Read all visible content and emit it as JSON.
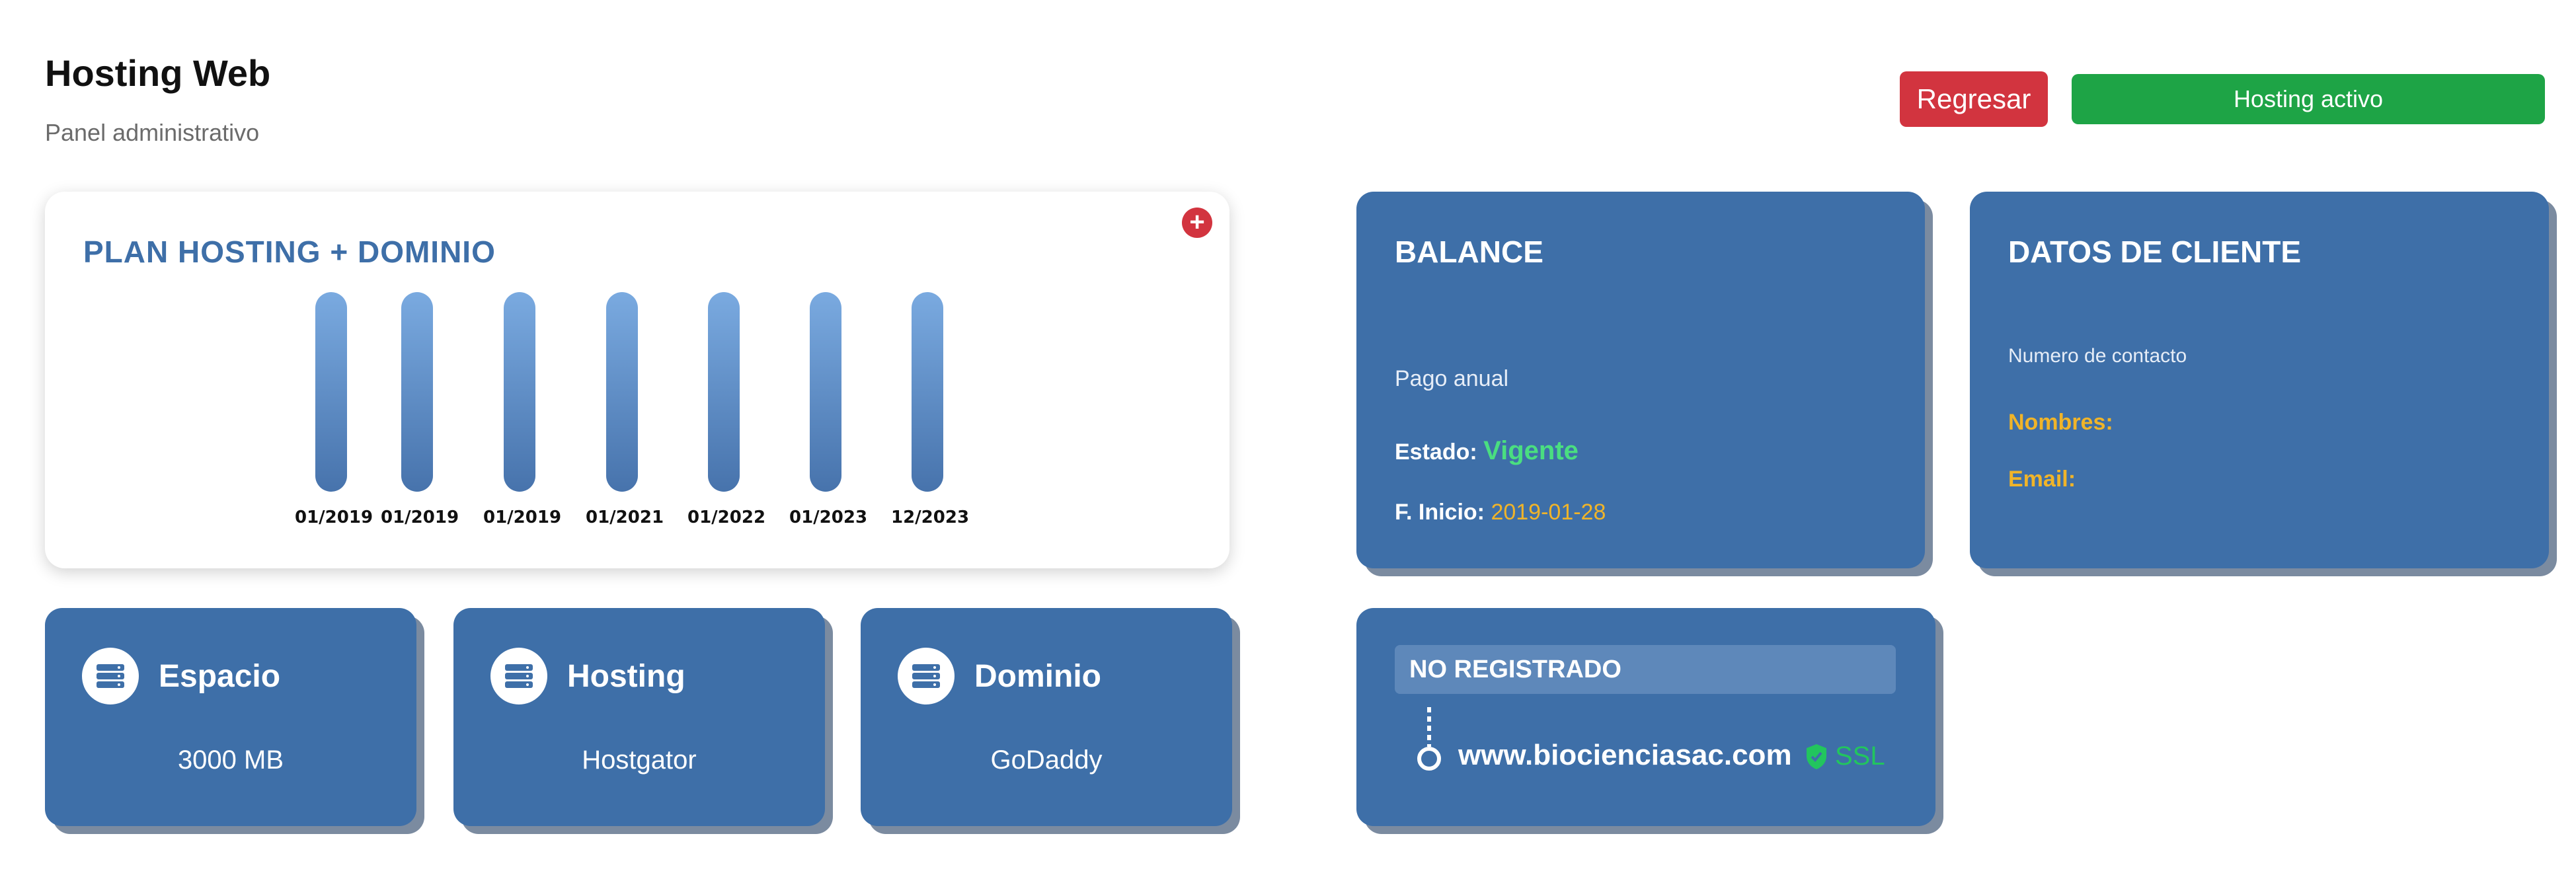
{
  "header": {
    "title": "Hosting Web",
    "subtitle": "Panel administrativo"
  },
  "actions": {
    "back_label": "Regresar",
    "status_label": "Hosting activo"
  },
  "plan": {
    "title": "PLAN HOSTING + DOMINIO",
    "add_label": "+",
    "timeline": [
      "01/2019",
      "01/2019",
      "01/2019",
      "01/2021",
      "01/2022",
      "01/2023",
      "12/2023"
    ]
  },
  "balance": {
    "title": "BALANCE",
    "payment": "Pago anual",
    "status_label": "Estado:",
    "status_value": "Vigente",
    "start_label": "F. Inicio:",
    "start_value": "2019-01-28"
  },
  "client": {
    "title": "DATOS DE CLIENTE",
    "contact_label": "Numero de contacto",
    "names_label": "Nombres:",
    "email_label": "Email:"
  },
  "resources": [
    {
      "title": "Espacio",
      "value": "3000 MB",
      "icon": "server-icon"
    },
    {
      "title": "Hosting",
      "value": "Hostgator",
      "icon": "server-icon"
    },
    {
      "title": "Dominio",
      "value": "GoDaddy",
      "icon": "server-icon"
    }
  ],
  "domain": {
    "badge": "NO REGISTRADO",
    "name": "www.biocienciasac.com",
    "ssl_label": "SSL",
    "ssl_icon": "shield-check-icon"
  },
  "colors": {
    "card_blue": "#3e6fa8",
    "danger": "#d2343f",
    "success": "#1ea446",
    "vigente": "#4ade80",
    "accent_yellow": "#f0b429"
  }
}
